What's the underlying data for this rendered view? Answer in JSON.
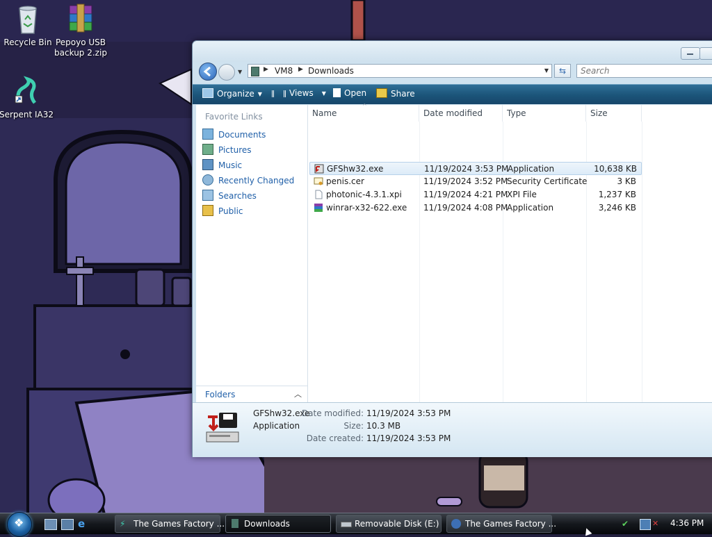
{
  "desktop": {
    "icons": [
      {
        "label": "Recycle Bin",
        "icon": "recycle-bin-icon"
      },
      {
        "label": "Pepoyo USB backup 2.zip",
        "label_line1": "Pepoyo USB",
        "label_line2": "backup 2.zip",
        "icon": "winrar-archive-icon"
      },
      {
        "label": "Serpent IA32",
        "icon": "serpent-shortcut-icon"
      }
    ]
  },
  "window": {
    "address": {
      "crumbs": [
        "VM8",
        "Downloads"
      ]
    },
    "search": {
      "placeholder": "Search"
    },
    "toolbar": {
      "organize": "Organize",
      "views": "Views",
      "open": "Open",
      "share": "Share"
    },
    "nav": {
      "heading": "Favorite Links",
      "items": [
        "Documents",
        "Pictures",
        "Music",
        "Recently Changed",
        "Searches",
        "Public"
      ],
      "folders_label": "Folders"
    },
    "columns": [
      "Name",
      "Date modified",
      "Type",
      "Size"
    ],
    "files": [
      {
        "name": "GFShw32.exe",
        "date": "11/19/2024 3:53 PM",
        "type": "Application",
        "size": "10,638 KB",
        "selected": true,
        "icon": "gfshw-exe-icon"
      },
      {
        "name": "penis.cer",
        "date": "11/19/2024 3:52 PM",
        "type": "Security Certificate",
        "size": "3 KB",
        "selected": false,
        "icon": "certificate-icon"
      },
      {
        "name": "photonic-4.3.1.xpi",
        "date": "11/19/2024 4:21 PM",
        "type": "XPI File",
        "size": "1,237 KB",
        "selected": false,
        "icon": "blank-file-icon"
      },
      {
        "name": "winrar-x32-622.exe",
        "date": "11/19/2024 4:08 PM",
        "type": "Application",
        "size": "3,246 KB",
        "selected": false,
        "icon": "winrar-installer-icon"
      }
    ],
    "details": {
      "name": "GFShw32.exe",
      "type": "Application",
      "date_modified_label": "Date modified:",
      "date_modified": "11/19/2024 3:53 PM",
      "size_label": "Size:",
      "size": "10.3 MB",
      "date_created_label": "Date created:",
      "date_created": "11/19/2024 3:53 PM"
    }
  },
  "taskbar": {
    "tasks": [
      {
        "label": "The Games Factory ...",
        "icon": "games-factory-icon"
      },
      {
        "label": "Downloads",
        "icon": "folder-icon",
        "active": true
      },
      {
        "label": "Removable Disk (E:)",
        "icon": "drive-icon"
      },
      {
        "label": "The Games Factory ...",
        "icon": "games-factory-icon"
      }
    ],
    "clock": "4:36 PM"
  }
}
